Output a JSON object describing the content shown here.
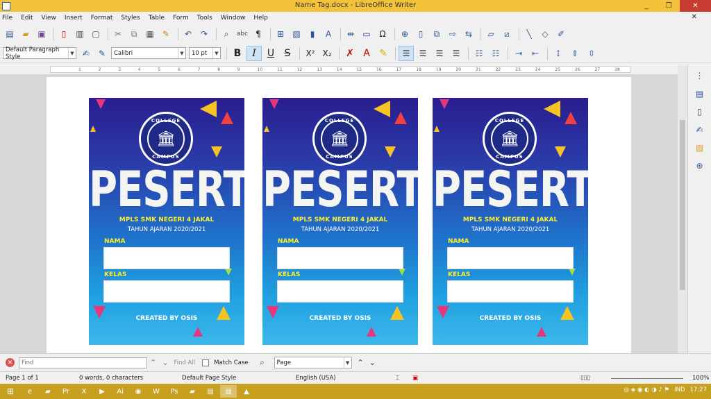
{
  "window": {
    "title": "Name Tag.docx - LibreOffice Writer",
    "minimize_label": "_",
    "maximize_label": "❐",
    "close_label": "✕"
  },
  "menu": {
    "items": [
      "File",
      "Edit",
      "View",
      "Insert",
      "Format",
      "Styles",
      "Table",
      "Form",
      "Tools",
      "Window",
      "Help"
    ],
    "close_doc": "✕"
  },
  "format_toolbar": {
    "paragraph_style": "Default Paragraph Style",
    "font_name": "Calibri",
    "font_size": "10 pt",
    "bold": "B",
    "italic": "I",
    "underline": "U",
    "strike": "S",
    "superscript": "X²",
    "subscript": "X₂"
  },
  "ruler": {
    "ticks": [
      "1",
      "2",
      "3",
      "4",
      "5",
      "6",
      "7",
      "8",
      "9",
      "10",
      "11",
      "12",
      "13",
      "14",
      "15",
      "16",
      "17",
      "18",
      "19",
      "20",
      "21",
      "22",
      "23",
      "24",
      "25",
      "26",
      "27",
      "28"
    ]
  },
  "name_tag": {
    "seal_top": "COLLEGE",
    "seal_bottom": "CAMPUS",
    "heading": "PESERTA",
    "event": "MPLS SMK NEGERI 4 JAKAL",
    "year": "TAHUN AJARAN 2020/2021",
    "name_label": "NAMA",
    "class_label": "KELAS",
    "footer": "CREATED BY OSIS"
  },
  "findbar": {
    "placeholder": "Find",
    "find_all": "Find All",
    "match_case": "Match Case",
    "search_type": "Page"
  },
  "statusbar": {
    "page": "Page 1 of 1",
    "words": "0 words, 0 characters",
    "page_style": "Default Page Style",
    "language": "English (USA)",
    "zoom": "100%"
  },
  "taskbar": {
    "lang": "IND",
    "time": "17:27"
  },
  "colors": {
    "titlebar": "#f3c23a",
    "tag_dark": "#2a1d8f",
    "tag_light": "#3bb8ea",
    "accent_yellow": "#ffef2a",
    "taskbar": "#c8a020"
  }
}
